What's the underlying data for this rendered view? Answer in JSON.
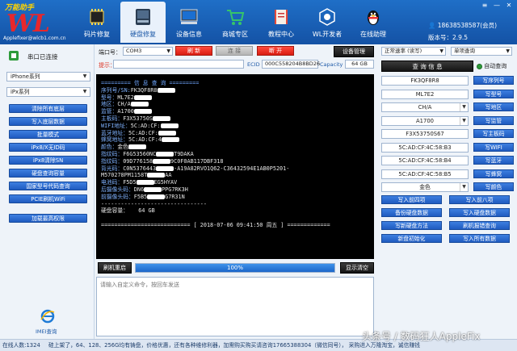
{
  "logo": {
    "top": "万能助手",
    "wl": "WL",
    "sub": "Applefixer@wlcb1.com.cn"
  },
  "nav": [
    {
      "label": "码片修复",
      "icon": "chip-icon"
    },
    {
      "label": "硬盘修复",
      "icon": "disk-icon"
    },
    {
      "label": "设备信息",
      "icon": "device-info-icon"
    },
    {
      "label": "商城专区",
      "icon": "cart-icon"
    },
    {
      "label": "教程中心",
      "icon": "book-icon"
    },
    {
      "label": "WL开发者",
      "icon": "developer-icon"
    },
    {
      "label": "在线助理",
      "icon": "qq-penguin-icon"
    }
  ],
  "user": {
    "phone": "18638538587(会员)",
    "version": "版本号：2.9.5"
  },
  "window_controls": [
    "≡",
    "—",
    "✕"
  ],
  "left": {
    "status": "串口已连接",
    "select1": "iPhone系列",
    "select2": "iPx系列",
    "buttons": [
      "清除所有底层",
      "写入底层数据",
      "批量模式",
      "iPx8/X无ID码",
      "iPx8清除SN",
      "硬盘查询容量",
      "国家型号代码查询",
      "PCIE刷机WiFi",
      "加载最高权限"
    ],
    "imei_label": "IMEI查询"
  },
  "toolbar": {
    "port_label": "端口号：",
    "port_value": "COM3",
    "refresh": "刷 新",
    "connect": "连 接",
    "disconnect": "断 开",
    "device_manage": "设备管理",
    "hint_label": "提示：",
    "ecid_label": "ECID",
    "ecid_value": "000C558204B8BD26",
    "capacity_label": "Capacity",
    "capacity_value": "64 GB"
  },
  "terminal": {
    "header": "========= 信 息 查 询 =========",
    "rows": [
      {
        "k": "序列号/SN:",
        "v": "FK3QF8R8"
      },
      {
        "k": "型号：",
        "v": "ML7E2"
      },
      {
        "k": "地区：",
        "v": "CH/A"
      },
      {
        "k": "监管：",
        "v": "A1700"
      },
      {
        "k": "主板码：",
        "v": "F3X53750S"
      },
      {
        "k": "WIFI地址：",
        "v": "5C:AD:CF:"
      },
      {
        "k": "蓝牙地址：",
        "v": "5C:AD:CF:"
      },
      {
        "k": "蜂窝地址：",
        "v": "5C:AD:CF:4"
      },
      {
        "k": "颜色：",
        "v": "金色"
      },
      {
        "k": "指纹码：",
        "v": "F6G53560NC",
        "t": "T9DAKA"
      },
      {
        "k": "指纹码：",
        "v": "09D776158",
        "t": "9C0F0AB117DBF318"
      },
      {
        "k": "背光码：",
        "v": "C0N5376443",
        "t": "-A19A82RVO1Q62-C36432594E1AB0P5201-"
      },
      {
        "k": "",
        "v": "M570278PM1158T",
        "t": "AA"
      },
      {
        "k": "电池码：",
        "v": "F5D5",
        "t": "EG5HYAV"
      },
      {
        "k": "后摄像头码：",
        "v": "DN6",
        "t": "PPG7RK3H"
      },
      {
        "k": "前摄像头码：",
        "v": "F5B5",
        "t": "G7R31N"
      }
    ],
    "divider": "--------------------------------",
    "capacity": "硬盘容量：   64 GB",
    "footer": "=========================== [ 2018-07-06 09:41:50 周五 ] ============="
  },
  "under": {
    "refresh": "刷机重启",
    "progress": "100%",
    "progress_value": 100,
    "clear": "显示清空",
    "placeholder": "请输入自定义命令，按回车发送"
  },
  "right": {
    "speed": "正常速率 (读写)",
    "mode": "单项查询",
    "query": "查 询 信 息",
    "auto": "自动查询",
    "fields": [
      {
        "value": "FK3QF8R8",
        "btn": "写序列号",
        "arrow": false
      },
      {
        "value": "ML7E2",
        "btn": "写型号",
        "arrow": false
      },
      {
        "value": "CH/A",
        "btn": "写地区",
        "arrow": true
      },
      {
        "value": "A1700",
        "btn": "写监管",
        "arrow": true
      },
      {
        "value": "F3X53750S67",
        "btn": "写主板码",
        "arrow": false
      },
      {
        "value": "5C:AD:CF:4C:58:B3",
        "btn": "写WIFI",
        "arrow": false
      },
      {
        "value": "5C:AD:CF:4C:58:B4",
        "btn": "写蓝牙",
        "arrow": false
      },
      {
        "value": "5C:AD:CF:4C:58:B5",
        "btn": "写蜂窝",
        "arrow": false
      },
      {
        "value": "金色",
        "btn": "写颜色",
        "arrow": true
      }
    ],
    "bottom_buttons": [
      [
        "写入前四项",
        "写入前八项"
      ],
      [
        "备份硬盘数据",
        "写入硬盘数据"
      ],
      [
        "写新硬盘方法",
        "刷机报错查询"
      ],
      [
        "新盘初始化",
        "写入所有数据"
      ]
    ]
  },
  "status": {
    "online": "在线人数:1324",
    "marquee": "硅上架了，64、128、256G均有铸盘，价格优惠，还有各种维修利器，加需购买购买请咨询17665388304（微信同号）， 采购进入万隆淘宝，诚信赚钱"
  },
  "watermark": "头条号 / 数码狂人AppleFix",
  "colors": {
    "nav_bg": "#1a5fb4",
    "accent_blue": "#1f5bc0",
    "red": "#e0251a",
    "terminal_bg": "#000000"
  }
}
